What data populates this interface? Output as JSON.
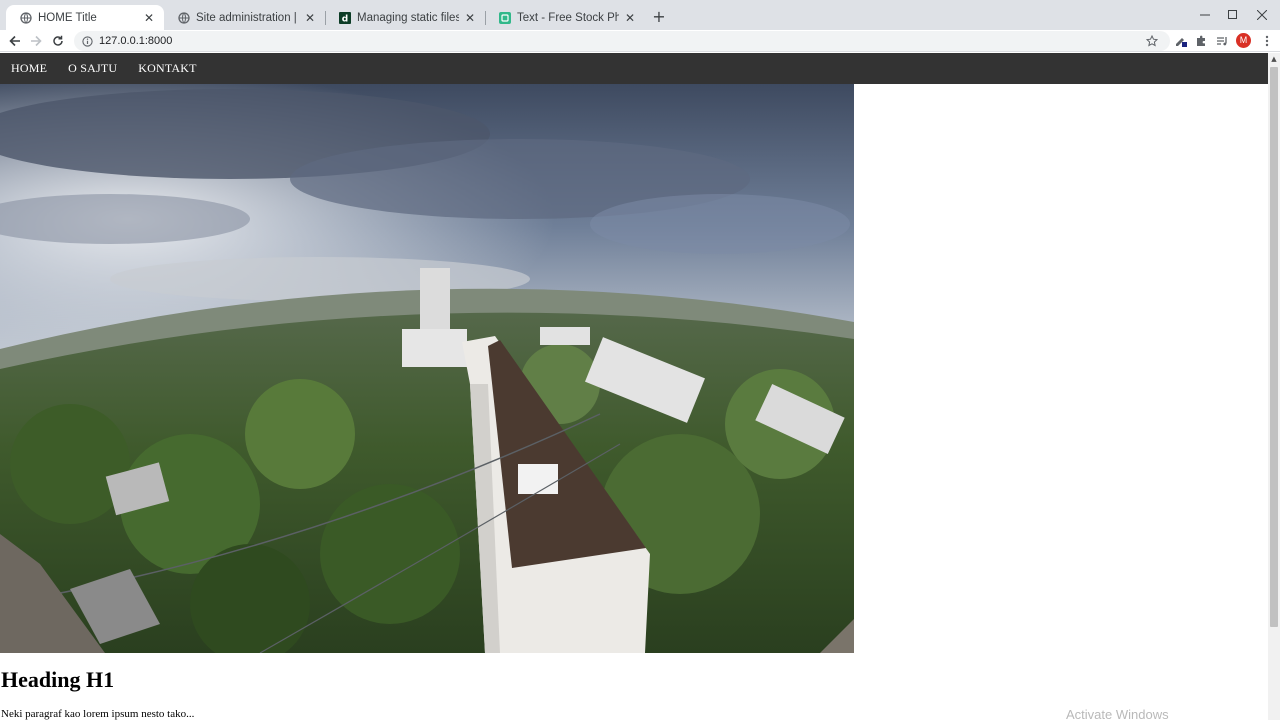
{
  "browser": {
    "tabs": [
      {
        "title": "HOME Title",
        "favicon": "globe-icon",
        "active": true
      },
      {
        "title": "Site administration | Django site",
        "favicon": "globe-icon",
        "active": false
      },
      {
        "title": "Managing static files (e.g. image",
        "favicon": "django-docs-icon",
        "active": false
      },
      {
        "title": "Text - Free Stock Photo",
        "favicon": "photo-site-icon",
        "active": false
      }
    ],
    "address": "127.0.0.1:8000",
    "profile_initial": "M",
    "accent_profile": "#d93025"
  },
  "site": {
    "nav": [
      "HOME",
      "O SAJTU",
      "KONTAKT"
    ],
    "hero_image": "aerial-city-photo",
    "heading": "Heading H1",
    "paragraph": "Neki paragraf kao lorem ipsum nesto tako...",
    "nav_bg": "#333333"
  },
  "os": {
    "watermark": "Activate Windows"
  }
}
